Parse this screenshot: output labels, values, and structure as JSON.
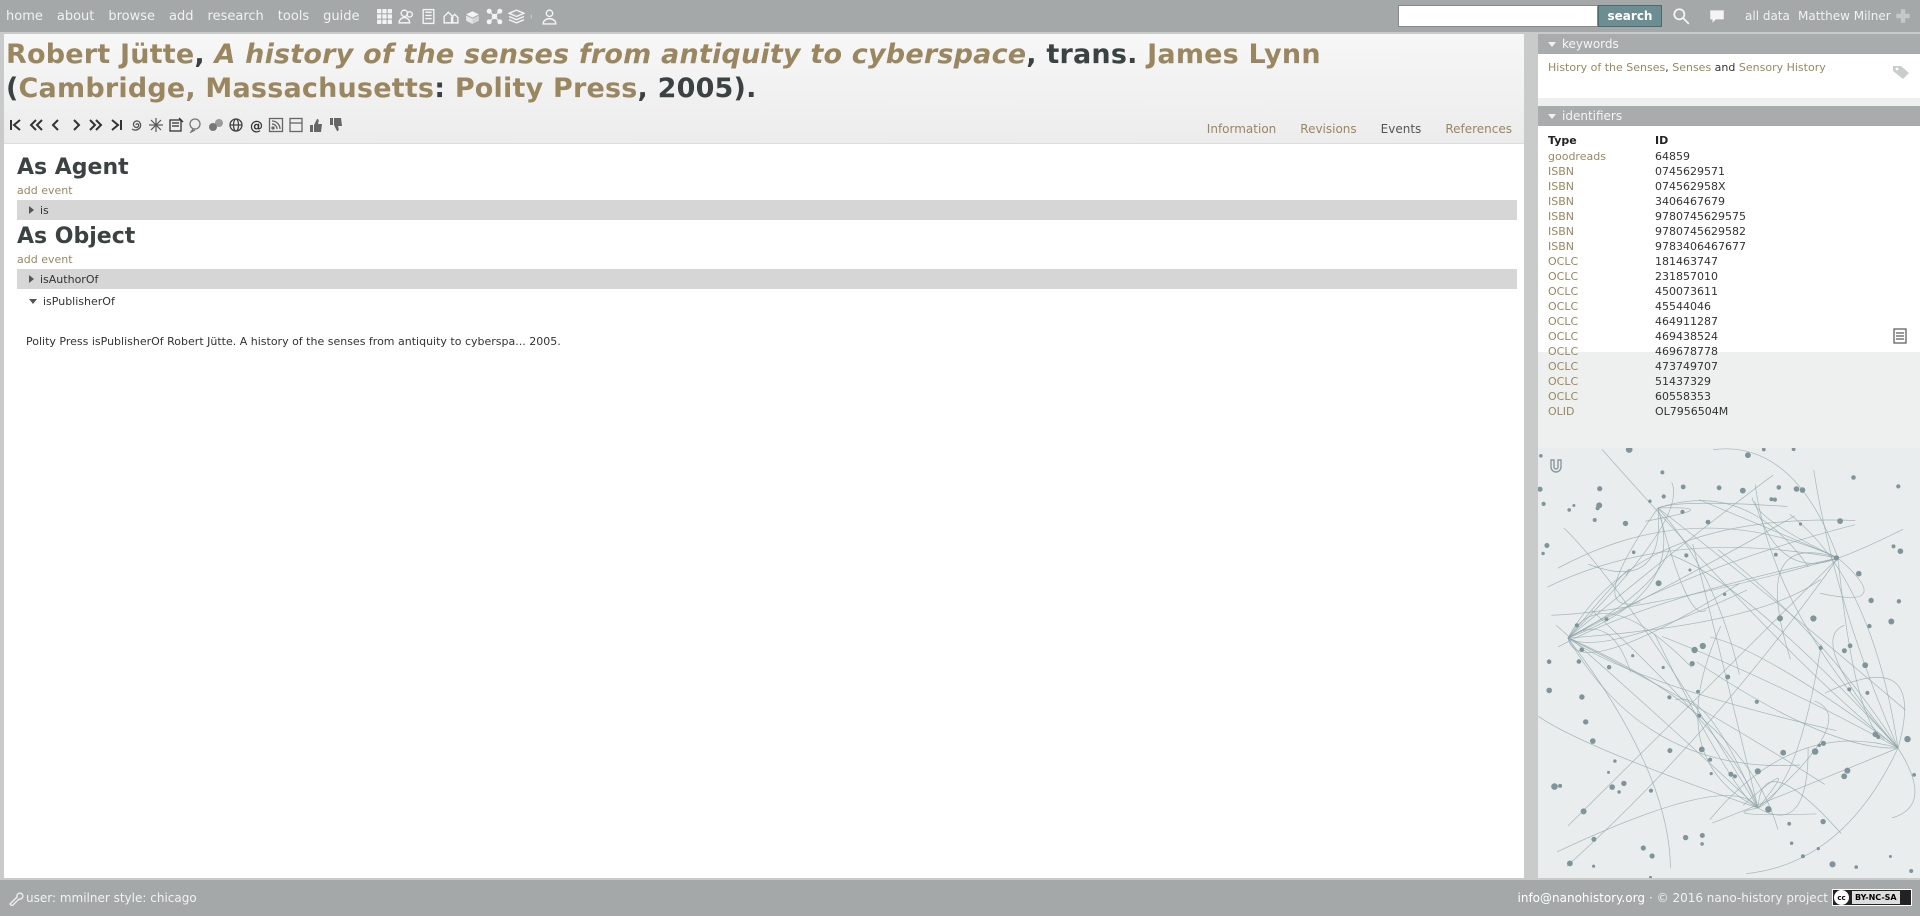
{
  "nav": {
    "links": [
      "home",
      "about",
      "browse",
      "add",
      "research",
      "tools",
      "guide"
    ],
    "icons": [
      "grid-icon",
      "people-icon",
      "book-icon",
      "places-icon",
      "things-icon",
      "network-icon",
      "layers-icon",
      "separator-icon",
      "users-icon"
    ],
    "search": {
      "placeholder": "",
      "value": "",
      "button_label": "search"
    },
    "all_data_label": "all data",
    "user_name": "Matthew Milner"
  },
  "title": {
    "author": "Robert Jütte",
    "work": "A history of the senses from antiquity to cyberspace",
    "trans_label": "trans.",
    "translator": "James Lynn",
    "place": "Cambridge, Massachusetts",
    "publisher": "Polity Press",
    "year": "2005"
  },
  "toolbar": {
    "icons": [
      "first-icon",
      "fast-back-icon",
      "prev-icon",
      "next-icon",
      "fast-forward-icon",
      "last-icon",
      "spiral-icon",
      "sparkle-icon",
      "recipe-icon",
      "bubble-icon",
      "circles-icon",
      "globe-icon",
      "at-icon",
      "rss-icon",
      "page-icon",
      "thumbs-up-icon",
      "thumbs-down-icon"
    ]
  },
  "tabs": [
    {
      "label": "Information"
    },
    {
      "label": "Revisions"
    },
    {
      "label": "Events"
    },
    {
      "label": "References"
    }
  ],
  "active_tab": "Events",
  "agent_section": {
    "heading": "As Agent",
    "add_event": "add event",
    "relations": [
      {
        "label": "is",
        "expanded": false
      }
    ]
  },
  "object_section": {
    "heading": "As Object",
    "add_event": "add event",
    "relations": [
      {
        "label": "isAuthorOf",
        "expanded": false
      },
      {
        "label": "isPublisherOf",
        "expanded": true
      }
    ],
    "event_text": "Polity Press isPublisherOf Robert Jütte. A history of the senses from antiquity to cyberspa... 2005."
  },
  "keywords": {
    "header": "keywords",
    "items": [
      "History of the Senses",
      "Senses",
      "Sensory History"
    ],
    "sep1": ", ",
    "sep2": " and "
  },
  "identifiers": {
    "header": "identifiers",
    "col_type": "Type",
    "col_id": "ID",
    "rows": [
      {
        "type": "goodreads",
        "id": "64859"
      },
      {
        "type": "ISBN",
        "id": "0745629571"
      },
      {
        "type": "ISBN",
        "id": "074562958X"
      },
      {
        "type": "ISBN",
        "id": "3406467679"
      },
      {
        "type": "ISBN",
        "id": "9780745629575"
      },
      {
        "type": "ISBN",
        "id": "9780745629582"
      },
      {
        "type": "ISBN",
        "id": "9783406467677"
      },
      {
        "type": "OCLC",
        "id": "181463747"
      },
      {
        "type": "OCLC",
        "id": "231857010"
      },
      {
        "type": "OCLC",
        "id": "450073611"
      },
      {
        "type": "OCLC",
        "id": "45544046"
      },
      {
        "type": "OCLC",
        "id": "464911287"
      },
      {
        "type": "OCLC",
        "id": "469438524"
      },
      {
        "type": "OCLC",
        "id": "469678778"
      },
      {
        "type": "OCLC",
        "id": "473749707"
      },
      {
        "type": "OCLC",
        "id": "51437329"
      },
      {
        "type": "OCLC",
        "id": "60558353"
      },
      {
        "type": "OLID",
        "id": "OL7956504M"
      }
    ]
  },
  "footer": {
    "user_style": "user: mmilner style: chicago",
    "email": "info@nanohistory.org",
    "copyright": " · © 2016 nano-history project",
    "license": "BY-NC-SA"
  },
  "colors": {
    "link": "#9a8760",
    "nav_bg": "#a4a8a8",
    "search_button": "#6c8e93",
    "network_line": "#8fa4a8",
    "network_node": "#7f9599"
  }
}
